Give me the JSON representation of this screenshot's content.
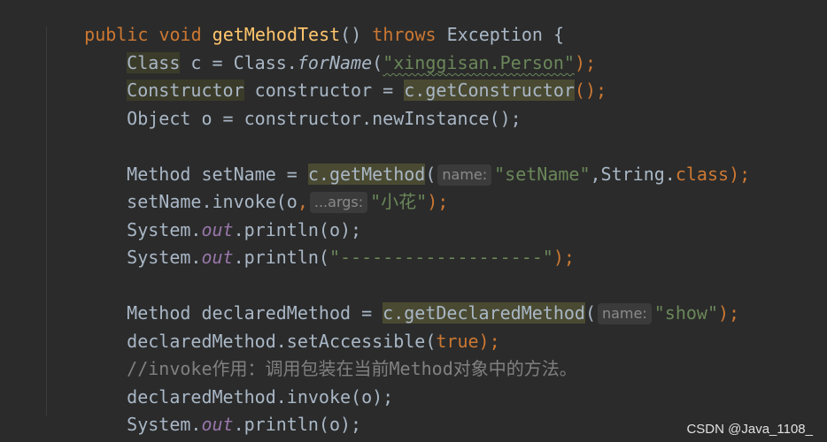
{
  "code": {
    "l1": {
      "a": "public void ",
      "b": "getMehodTest",
      "c": "() ",
      "d": "throws",
      "e": " Exception {"
    },
    "l2": {
      "a": "Class",
      "b": " c = Class.",
      "c": "forName",
      "d": "(",
      "e": "\"xinggisan.Person\"",
      "f": ");"
    },
    "l3": {
      "a": "Constructor",
      "b": " constructor = ",
      "c": "c.getConstructor",
      "d": "();"
    },
    "l4": {
      "a": "Object o = constructor.newInstance();"
    },
    "l5": {
      "a": "Method setName = ",
      "b": "c.getMethod",
      "c": "(",
      "hint": "name:",
      "d": "\"setName\"",
      "e": ",String.",
      "f": "class",
      "g": ");"
    },
    "l6": {
      "a": "setName.invoke(o",
      "b": ",",
      "hint": "...args:",
      "c": "\"小花\"",
      "d": ");"
    },
    "l7": {
      "a": "System.",
      "b": "out",
      "c": ".println(o);"
    },
    "l8": {
      "a": "System.",
      "b": "out",
      "c": ".println(",
      "d": "\"-------------------\"",
      "e": ");"
    },
    "l9": {
      "a": "Method declaredMethod = ",
      "b": "c.getDeclaredMethod",
      "c": "(",
      "hint": "name:",
      "d": "\"show\"",
      "e": ");"
    },
    "l10": {
      "a": "declaredMethod.setAccessible(",
      "b": "true",
      "c": ");"
    },
    "l11": {
      "a": "//invoke作用：调用包装在当前Method对象中的方法。"
    },
    "l12": {
      "a": "declaredMethod.invoke(o);"
    },
    "l13": {
      "a": "System.",
      "b": "out",
      "c": ".println(o);"
    },
    "l14": {
      "a": "}"
    }
  },
  "watermark": "CSDN @Java_1108_",
  "colors": {
    "background": "#2b2b2b",
    "keyword": "#cc7832",
    "method_decl": "#ffc66d",
    "string": "#6a8759",
    "static_field": "#9876aa",
    "comment": "#808080",
    "default_text": "#a9b7c6"
  }
}
